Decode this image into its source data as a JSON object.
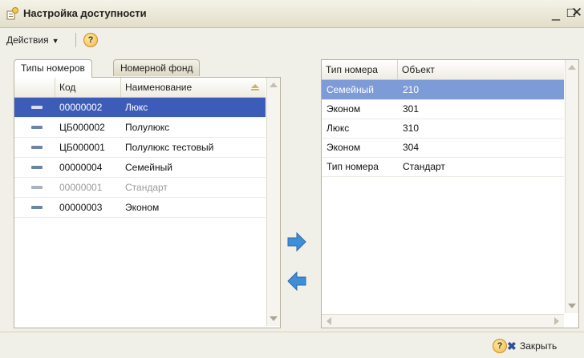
{
  "window": {
    "title": "Настройка доступности"
  },
  "toolbar": {
    "actions_label": "Действия",
    "help_glyph": "?"
  },
  "tabs": [
    {
      "label": "Типы номеров",
      "active": true
    },
    {
      "label": "Номерной фонд",
      "active": false
    }
  ],
  "left_table": {
    "columns": [
      "Код",
      "Наименование"
    ],
    "rows": [
      {
        "code": "00000002",
        "name": "Люкс",
        "selected": true,
        "dim": false
      },
      {
        "code": "ЦБ000002",
        "name": "Полулюкс",
        "selected": false,
        "dim": false
      },
      {
        "code": "ЦБ000001",
        "name": "Полулюкс тестовый",
        "selected": false,
        "dim": false
      },
      {
        "code": "00000004",
        "name": "Семейный",
        "selected": false,
        "dim": false
      },
      {
        "code": "00000001",
        "name": "Стандарт",
        "selected": false,
        "dim": true
      },
      {
        "code": "00000003",
        "name": "Эконом",
        "selected": false,
        "dim": false
      }
    ]
  },
  "right_table": {
    "columns": [
      "Тип номера",
      "Объект"
    ],
    "rows": [
      {
        "type": "Семейный",
        "object": "210",
        "selected": true
      },
      {
        "type": "Эконом",
        "object": "301",
        "selected": false
      },
      {
        "type": "Люкс",
        "object": "310",
        "selected": false
      },
      {
        "type": "Эконом",
        "object": "304",
        "selected": false
      },
      {
        "type": "Тип номера",
        "object": "Стандарт",
        "selected": false
      }
    ]
  },
  "footer": {
    "help_glyph": "?",
    "close_label": "Закрыть"
  },
  "colors": {
    "selection": "#3d5cb8",
    "selection_light": "#7d9bd6",
    "arrow": "#3f8fd8",
    "accent": "#2d4f9a"
  }
}
